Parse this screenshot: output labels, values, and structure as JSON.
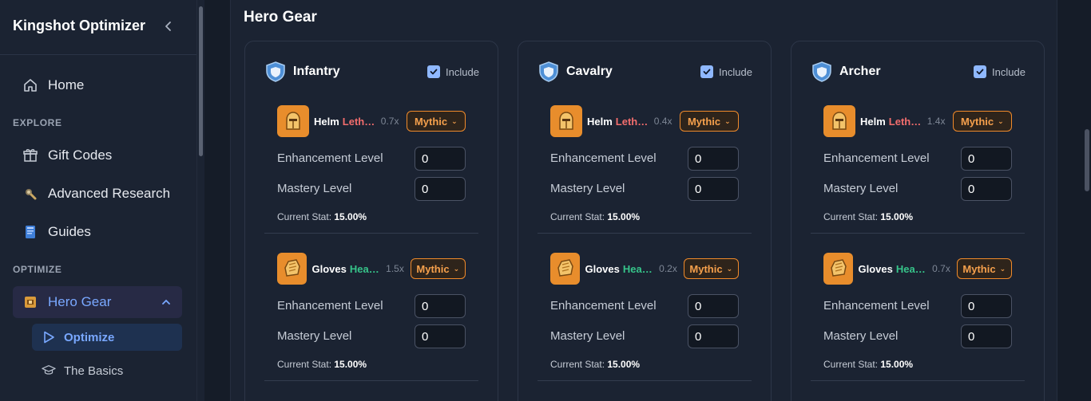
{
  "sidebar": {
    "brand": "Kingshot Optimizer",
    "home": "Home",
    "explore_section": "EXPLORE",
    "gift_codes": "Gift Codes",
    "advanced_research": "Advanced Research",
    "guides": "Guides",
    "optimize_section": "OPTIMIZE",
    "hero_gear": "Hero Gear",
    "optimize": "Optimize",
    "the_basics": "The Basics"
  },
  "page": {
    "title": "Hero Gear"
  },
  "include_label": "Include",
  "labels": {
    "enhancement": "Enhancement Level",
    "mastery": "Mastery Level",
    "current_stat": "Current Stat:"
  },
  "cards": [
    {
      "title": "Infantry",
      "gear": [
        {
          "name": "Helm",
          "stat": "Lethality",
          "mult": "0.7x",
          "tier": "Mythic",
          "enhancement": "0",
          "mastery": "0",
          "current": "15.00%"
        },
        {
          "name": "Gloves",
          "stat": "Health",
          "mult": "1.5x",
          "tier": "Mythic",
          "enhancement": "0",
          "mastery": "0",
          "current": "15.00%"
        }
      ]
    },
    {
      "title": "Cavalry",
      "gear": [
        {
          "name": "Helm",
          "stat": "Lethality",
          "mult": "0.4x",
          "tier": "Mythic",
          "enhancement": "0",
          "mastery": "0",
          "current": "15.00%"
        },
        {
          "name": "Gloves",
          "stat": "Health",
          "mult": "0.2x",
          "tier": "Mythic",
          "enhancement": "0",
          "mastery": "0",
          "current": "15.00%"
        }
      ]
    },
    {
      "title": "Archer",
      "gear": [
        {
          "name": "Helm",
          "stat": "Lethality",
          "mult": "1.4x",
          "tier": "Mythic",
          "enhancement": "0",
          "mastery": "0",
          "current": "15.00%"
        },
        {
          "name": "Gloves",
          "stat": "Health",
          "mult": "0.7x",
          "tier": "Mythic",
          "enhancement": "0",
          "mastery": "0",
          "current": "15.00%"
        }
      ]
    }
  ],
  "colors": {
    "accent": "#79a8ff",
    "mythic": "#f08a2a",
    "lethality": "#f26d6d",
    "health": "#36c48a"
  }
}
